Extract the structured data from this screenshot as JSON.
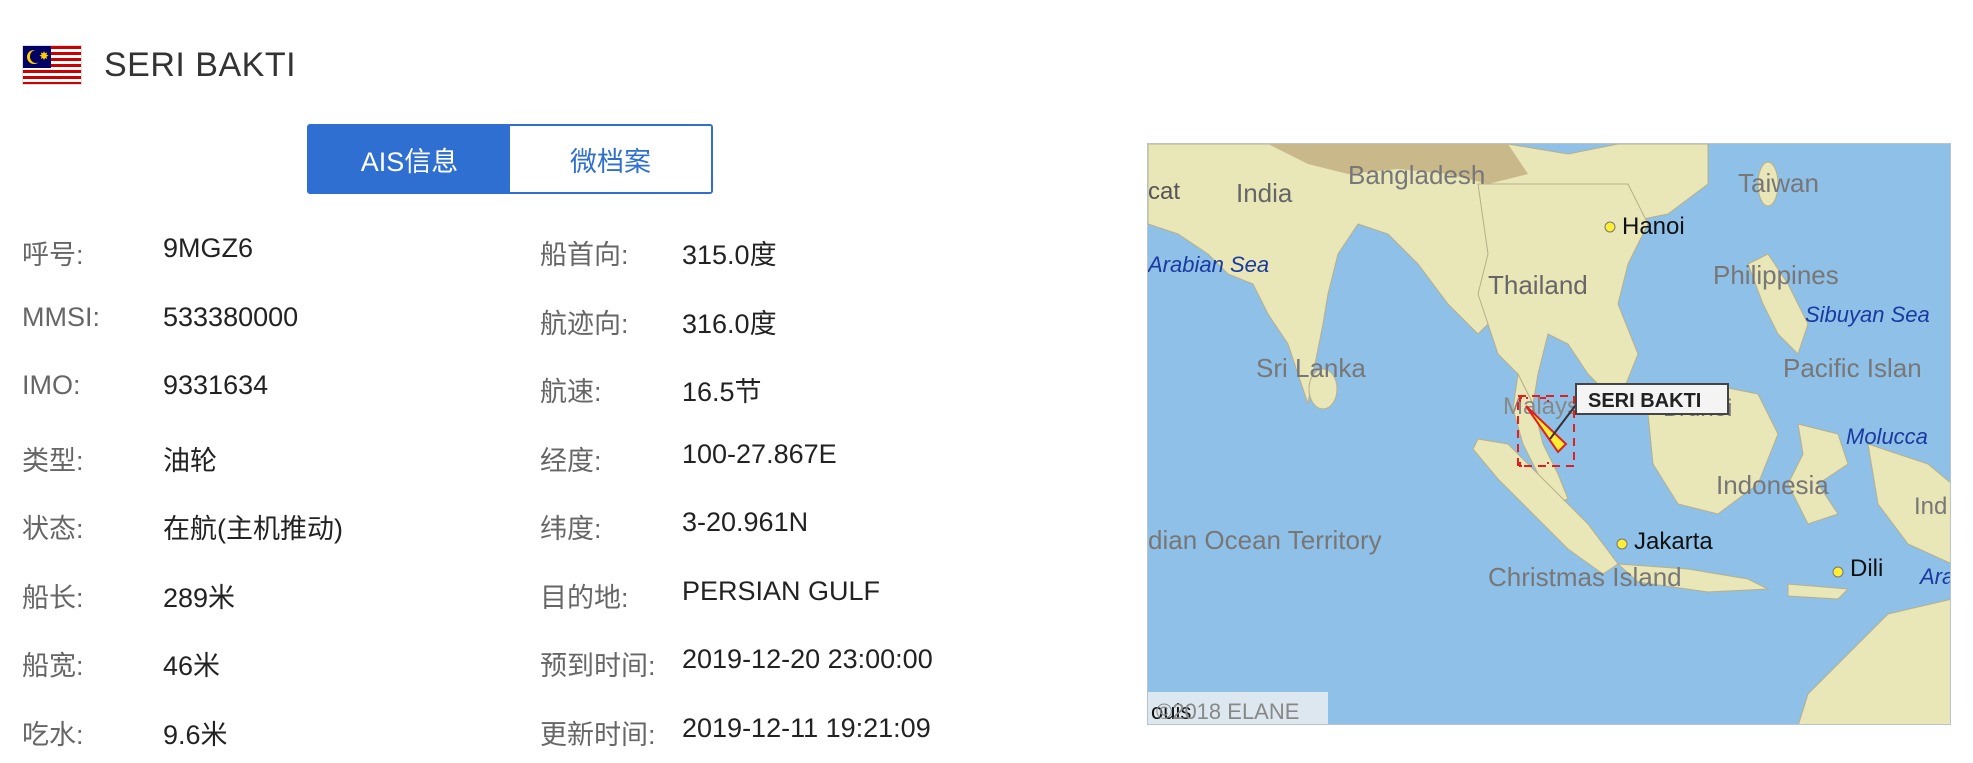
{
  "vessel": {
    "name": "SERI BAKTI"
  },
  "tabs": [
    {
      "label": "AIS信息",
      "active": true
    },
    {
      "label": "微档案",
      "active": false
    }
  ],
  "left_fields": [
    {
      "label": "呼号:",
      "value": "9MGZ6"
    },
    {
      "label": "MMSI:",
      "value": "533380000"
    },
    {
      "label": "IMO:",
      "value": "9331634"
    },
    {
      "label": "类型:",
      "value": "油轮"
    },
    {
      "label": "状态:",
      "value": "在航(主机推动)"
    },
    {
      "label": "船长:",
      "value": "289米"
    },
    {
      "label": "船宽:",
      "value": "46米"
    },
    {
      "label": "吃水:",
      "value": "9.6米"
    }
  ],
  "right_fields": [
    {
      "label": "船首向:",
      "value": "315.0度"
    },
    {
      "label": "航迹向:",
      "value": "316.0度"
    },
    {
      "label": "航速:",
      "value": "16.5节"
    },
    {
      "label": "经度:",
      "value": "100-27.867E"
    },
    {
      "label": "纬度:",
      "value": "3-20.961N"
    },
    {
      "label": "目的地:",
      "value": "PERSIAN GULF"
    },
    {
      "label": "预到时间:",
      "value": "2019-12-20 23:00:00"
    },
    {
      "label": "更新时间:",
      "value": "2019-12-11 19:21:09"
    }
  ],
  "map": {
    "ship_label": "SERI BAKTI",
    "copyright": "©2018 ELANE",
    "labels": {
      "india": "India",
      "bangladesh": "Bangladesh",
      "taiwan": "Taiwan",
      "hanoi": "Hanoi",
      "arabian_sea": "Arabian Sea",
      "thailand": "Thailand",
      "philippines": "Philippines",
      "sibuyan": "Sibuyan Sea",
      "sri_lanka": "Sri Lanka",
      "pacific": "Pacific Islan",
      "malaysia": "Malaysia",
      "brunei": "Brunei",
      "molucca": "Molucca",
      "indonesia": "Indonesia",
      "ind": "Ind",
      "ocean_territory": "dian Ocean Territory",
      "jakarta": "Jakarta",
      "dili": "Dili",
      "ara": "Ara",
      "christmas": "Christmas Island",
      "cat": "cat",
      "ouis": "ouis"
    },
    "colors": {
      "sea": "#8fc0e8",
      "land": "#e9e6b8",
      "highland": "#c9b98a",
      "ship_marker": "#e02020"
    }
  }
}
